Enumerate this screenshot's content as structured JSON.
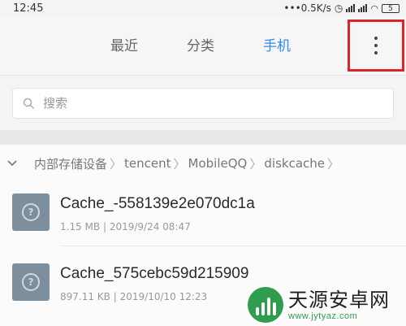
{
  "status_bar": {
    "time": "12:45",
    "network_speed": "•••0.5K/s",
    "battery": "5"
  },
  "tabs": [
    {
      "label": "最近",
      "active": false
    },
    {
      "label": "分类",
      "active": false
    },
    {
      "label": "手机",
      "active": true
    }
  ],
  "colors": {
    "accent": "#2f8cf0",
    "highlight_box": "#d9262c",
    "file_icon": "#7d8f9d"
  },
  "search": {
    "placeholder": "搜索"
  },
  "breadcrumb": [
    "内部存储设备",
    "tencent",
    "MobileQQ",
    "diskcache"
  ],
  "files": [
    {
      "name": "Cache_-558139e2e070dc1a",
      "size": "1.15 MB",
      "date": "2019/9/24 08:47"
    },
    {
      "name": "Cache_575cebc59d215909",
      "size": "897.11 KB",
      "date": "2019/10/10 12:23"
    }
  ],
  "watermark": {
    "title": "天源安卓网",
    "url": "www.jytyaz.com"
  }
}
